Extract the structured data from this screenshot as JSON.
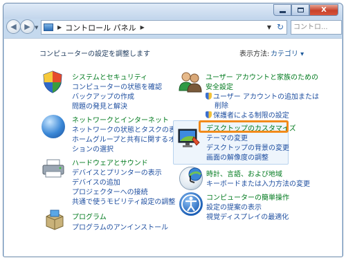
{
  "window": {
    "buttons": {
      "minimize_icon": "minimize-icon",
      "maximize_icon": "maximize-icon",
      "close_label": "X"
    }
  },
  "address_bar": {
    "breadcrumbs": [
      "コントロール パネル"
    ],
    "search_placeholder": "コントロ..."
  },
  "page": {
    "heading": "コンピューターの設定を調整します",
    "view_by_label": "表示方法:",
    "view_by_value": "カテゴリ ▾"
  },
  "left_categories": [
    {
      "title": "システムとセキュリティ",
      "icon": "security-shield-icon",
      "links": [
        "コンピューターの状態を確認",
        "バックアップの作成",
        "問題の発見と解決"
      ]
    },
    {
      "title": "ネットワークとインターネット",
      "icon": "network-globe-icon",
      "links": [
        "ネットワークの状態とタスクの表示",
        "ホームグループと共有に関するオプ",
        "ションの選択"
      ]
    },
    {
      "title": "ハードウェアとサウンド",
      "icon": "printer-icon",
      "links": [
        "デバイスとプリンターの表示",
        "デバイスの追加",
        "プロジェクターへの接続",
        "共通で使うモビリティ設定の調整"
      ]
    },
    {
      "title": "プログラム",
      "icon": "programs-icon",
      "links": [
        "プログラムのアンインストール"
      ]
    }
  ],
  "right_categories": [
    {
      "title": "ユーザー アカウントと家族のための",
      "title2": "安全設定",
      "icon": "users-icon",
      "links": [
        "ユーザー アカウントの追加または",
        "削除",
        "保護者による制限の設定"
      ]
    },
    {
      "title": "デスクトップのカスタマイズ",
      "icon": "display-icon",
      "links": [
        "テーマの変更",
        "デスクトップの背景の変更",
        "画面の解像度の調整"
      ]
    },
    {
      "title": "時計、言語、および地域",
      "icon": "clock-globe-icon",
      "links": [
        "キーボードまたは入力方法の変更"
      ]
    },
    {
      "title": "コンピューターの簡単操作",
      "icon": "ease-of-access-icon",
      "links": [
        "設定の提案の表示",
        "視覚ディスプレイの最適化"
      ]
    }
  ],
  "colors": {
    "category_title": "#007a1e",
    "link": "#1f4fa0",
    "highlight_border": "#f28a1a"
  }
}
